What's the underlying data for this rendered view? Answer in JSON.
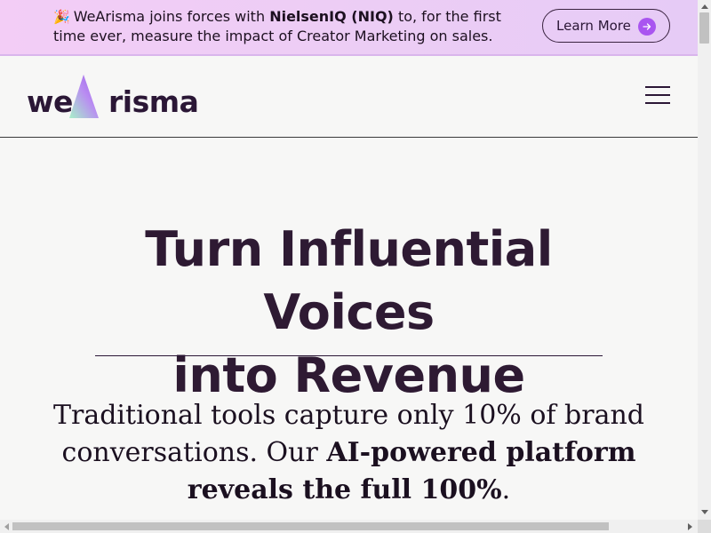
{
  "announcement": {
    "emoji": "🎉",
    "text_before": "WeArisma joins forces with ",
    "text_bold": "NielsenIQ (NIQ)",
    "text_after": " to, for the first time ever, measure the impact of Creator Marketing on sales.",
    "cta_label": "Learn More",
    "cta_icon": "arrow-right-icon"
  },
  "header": {
    "logo_text_start": "we",
    "logo_text_end": "risma",
    "menu_icon": "hamburger-menu-icon"
  },
  "hero": {
    "title_line1": "Turn Influential Voices",
    "title_line2": "into Revenue",
    "subtitle_before": "Traditional tools capture only 10% of brand conversations. Our ",
    "subtitle_bold": "AI-powered platform reveals the full 100%",
    "subtitle_after": "."
  },
  "colors": {
    "announcement_bg": "#eccdf5",
    "accent_purple": "#a955f0",
    "text_dark": "#2b1736",
    "page_bg": "#f7f7f6"
  }
}
